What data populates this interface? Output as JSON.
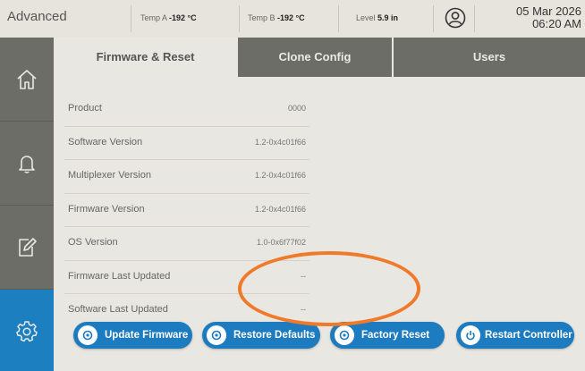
{
  "header": {
    "title": "Advanced",
    "temp_a_label": "Temp A",
    "temp_a_value": "-192 °C",
    "temp_b_label": "Temp B",
    "temp_b_value": "-192 °C",
    "level_label": "Level",
    "level_value": "5.9 in",
    "date": "05 Mar 2026",
    "time": "06:20 AM",
    "user_icon": "user-circle-icon"
  },
  "sidebar": {
    "items": [
      {
        "icon": "home-icon",
        "active": false
      },
      {
        "icon": "bell-icon",
        "active": false
      },
      {
        "icon": "edit-icon",
        "active": false
      },
      {
        "icon": "gear-icon",
        "active": true
      }
    ]
  },
  "tabs": [
    {
      "label": "Firmware & Reset",
      "active": true
    },
    {
      "label": "Clone Config",
      "active": false
    },
    {
      "label": "Users",
      "active": false
    }
  ],
  "info_rows": [
    {
      "label": "Product",
      "value": "0000"
    },
    {
      "label": "Software Version",
      "value": "1.2-0x4c01f66"
    },
    {
      "label": "Multiplexer Version",
      "value": "1.2-0x4c01f66"
    },
    {
      "label": "Firmware Version",
      "value": "1.2-0x4c01f66"
    },
    {
      "label": "OS Version",
      "value": "1.0-0x6f77f02"
    },
    {
      "label": "Firmware Last Updated",
      "value": "--"
    },
    {
      "label": "Software Last Updated",
      "value": "--"
    }
  ],
  "buttons": {
    "update_firmware": "Update Firmware",
    "restore_defaults": "Restore Defaults",
    "factory_reset": "Factory Reset",
    "restart_controller": "Restart Controller"
  },
  "colors": {
    "accent": "#1d7bbf",
    "sidebar": "#6c6d66",
    "highlight": "#f07a2a"
  }
}
